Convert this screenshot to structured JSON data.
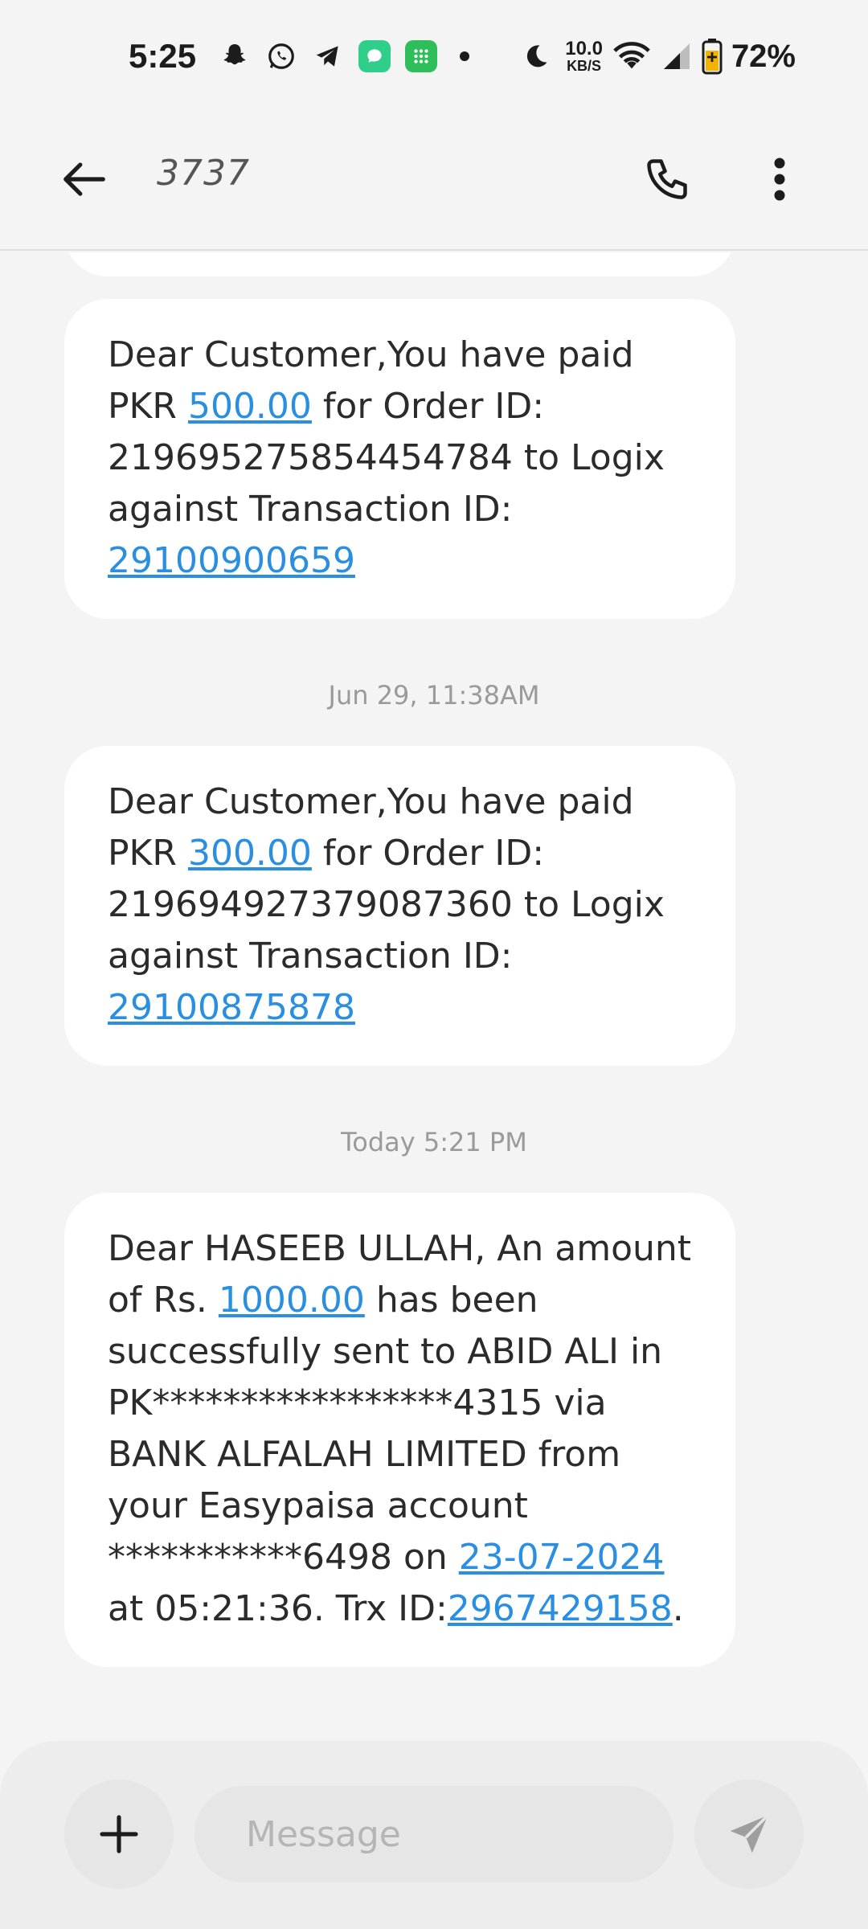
{
  "status_bar": {
    "time": "5:25",
    "net_speed_value": "10.0",
    "net_speed_unit": "KB/S",
    "battery_percent": "72%",
    "icons": [
      "snapchat-icon",
      "whatsapp-icon",
      "telegram-icon",
      "messages-app-icon",
      "launcher-app-icon",
      "notification-dot",
      "moon-icon",
      "wifi-icon",
      "signal-icon",
      "battery-icon"
    ],
    "colors": {
      "messages_app": "#2fcf8a",
      "launcher_app": "#2fbf5a"
    }
  },
  "header": {
    "contact": "3737",
    "back_icon": "arrow-left-icon",
    "call_icon": "phone-icon",
    "more_icon": "more-vertical-icon"
  },
  "conversation": {
    "messages": [
      {
        "text_before": "Dear Customer,You have paid PKR ",
        "amount": "500.00",
        "text_middle": " for Order ID: 219695275854454784 to Logix against Transaction ID: ",
        "transaction_id": "29100900659"
      },
      {
        "timestamp": "Jun 29, 11:38AM",
        "text_before": "Dear Customer,You have paid PKR ",
        "amount": "300.00",
        "text_middle": " for Order ID: 219694927379087360 to Logix against Transaction ID: ",
        "transaction_id": "29100875878"
      },
      {
        "timestamp": "Today 5:21 PM",
        "text_before": "Dear HASEEB ULLAH, An amount of Rs. ",
        "amount": "1000.00",
        "text_middle": " has been successfully sent to ABID ALI in PK*****************4315 via BANK ALFALAH LIMITED from your Easypaisa account ***********6498 on ",
        "date": "23-07-2024",
        "text_after_date": " at 05:21:36. Trx ID:",
        "transaction_id": "2967429158",
        "text_end": "."
      }
    ],
    "link_color": "#2a8fe0"
  },
  "composer": {
    "placeholder": "Message",
    "add_icon": "plus-icon",
    "send_icon": "send-icon"
  }
}
